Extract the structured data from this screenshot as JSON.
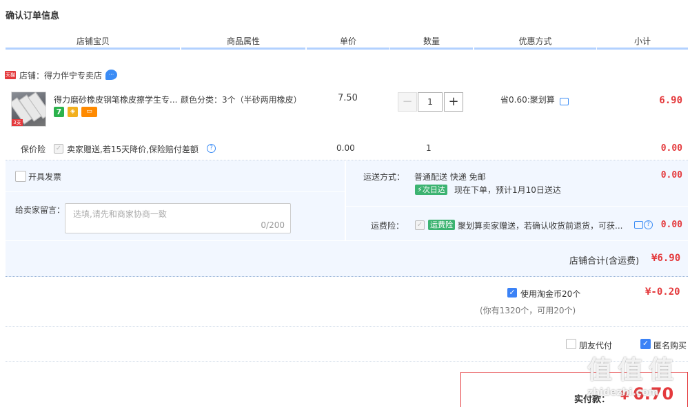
{
  "page": {
    "title": "确认订单信息"
  },
  "header": {
    "columns": [
      "店铺宝贝",
      "商品属性",
      "单价",
      "数量",
      "优惠方式",
      "小计"
    ]
  },
  "store": {
    "icon_text": "天猫",
    "label": "店铺：得力伴宁专卖店",
    "chat_badge": "···"
  },
  "item": {
    "title": "得力磨砂橡皮钢笔橡皮擦学生专...",
    "attribute": "颜色分类：3个（半砂两用橡皮）",
    "unit_price": "7.50",
    "quantity": "1",
    "minus": "−",
    "plus": "+",
    "discount": "省0.60:聚划算",
    "subtotal": "6.90",
    "thumb_tag": "3支装"
  },
  "insurance": {
    "label": "保价险",
    "text": "卖家赠送,若15天降价,保险赔付差额",
    "price": "0.00",
    "qty": "1",
    "subtotal": "0.00"
  },
  "invoice": {
    "label": "开具发票"
  },
  "message": {
    "label": "给卖家留言：",
    "placeholder": "选填,请先和商家协商一致",
    "counter": "0/200"
  },
  "shipping": {
    "label": "运送方式：",
    "method": "普通配送 快递 免邮",
    "next_day_tag": "次日达",
    "eta": "现在下单，预计1月10日送达",
    "price": "0.00"
  },
  "freight_insurance": {
    "label": "运费险：",
    "tag": "运费险",
    "text": "聚划算卖家赠送，若确认收货前退货，可获...",
    "price": "0.00"
  },
  "store_total": {
    "label": "店铺合计(含运费)",
    "value": "¥6.90"
  },
  "coins": {
    "label": "使用淘金币20个",
    "hint": "(你有1320个，可用20个)",
    "value": "¥-0.20"
  },
  "options": {
    "friend_pay": "朋友代付",
    "anonymous": "匿名购买"
  },
  "payment": {
    "label": "实付款：",
    "currency": "¥",
    "value": "6.70"
  },
  "watermark": {
    "text": "值 值 值",
    "url": "zhidezhi.com"
  },
  "colors": {
    "accent": "#e4393c",
    "header_line": "#b2d1ff",
    "panel_bg": "#f2f7ff",
    "check_on": "#3b82f6"
  }
}
